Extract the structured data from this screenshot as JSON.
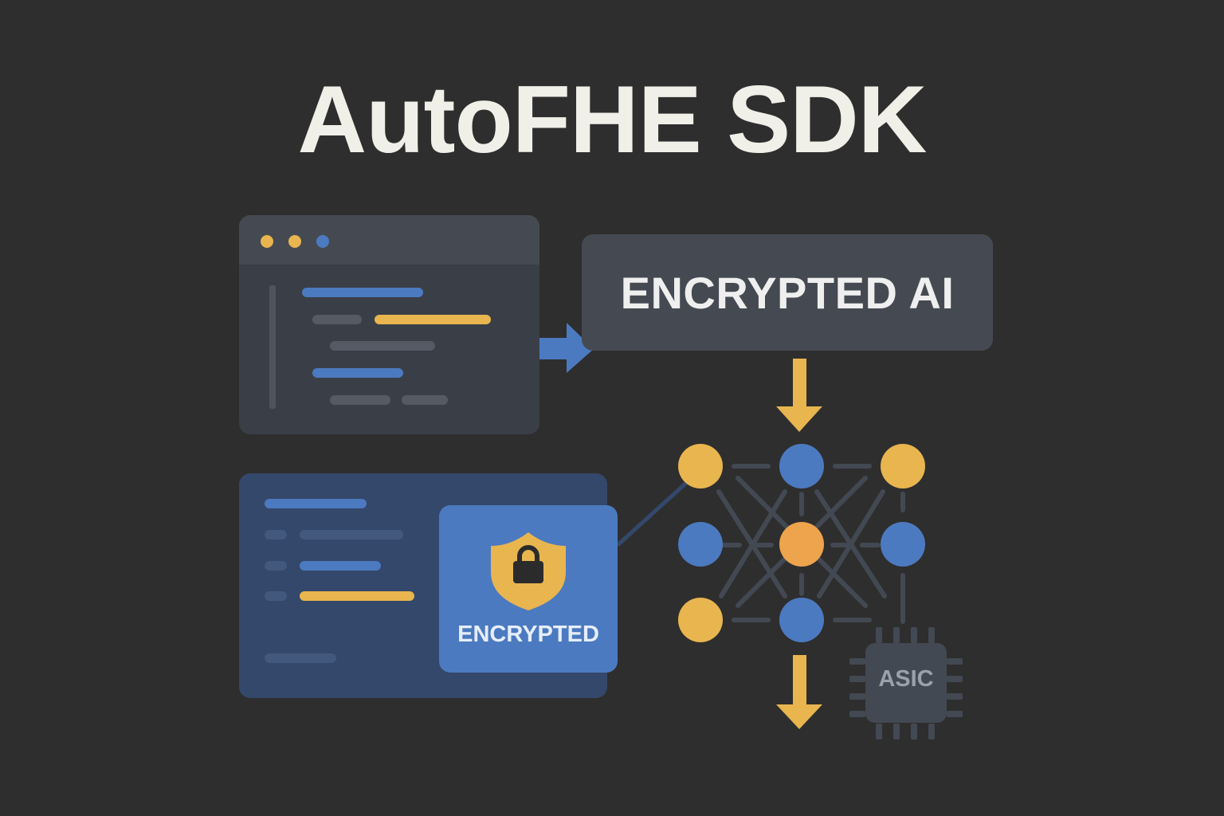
{
  "title": "AutoFHE SDK",
  "process_box": {
    "label": "ENCRYPTED AI"
  },
  "encrypted_badge": {
    "label": "ENCRYPTED",
    "icon": "shield-lock-icon"
  },
  "asic_chip": {
    "label": "ASIC",
    "icon": "chip-icon"
  },
  "code_window": {
    "icon": "code-window-icon",
    "traffic_lights": [
      "#e8b54f",
      "#e8b54f",
      "#4c7ac0"
    ]
  },
  "neural_network": {
    "icon": "neural-network-icon",
    "layers": [
      3,
      3,
      3
    ]
  },
  "colors": {
    "background": "#2e2e2e",
    "accent_blue": "#4c7ac0",
    "accent_yellow": "#e8b54f",
    "accent_orange": "#eea44c",
    "panel_dark": "#3a3f47",
    "panel_titlebar": "#454a52",
    "panel_blue": "#34486b",
    "text_light": "#f0efe8"
  }
}
